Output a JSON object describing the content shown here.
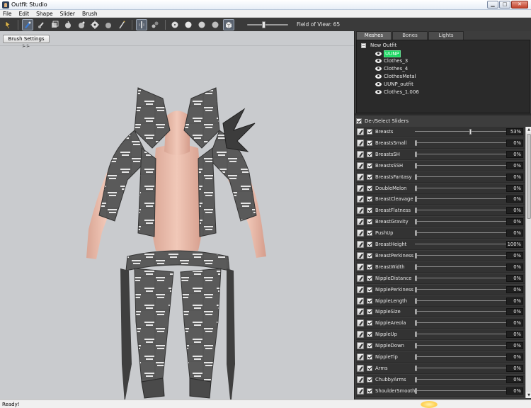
{
  "window": {
    "title": "Outfit Studio",
    "buttons": [
      "▁",
      "□",
      "✕"
    ]
  },
  "menu": [
    "File",
    "Edit",
    "Shape",
    "Slider",
    "Brush"
  ],
  "toolbar": {
    "field_of_view_label": "Field of View: 65",
    "field_of_view_level": 0.4,
    "icons": [
      "select-icon",
      "inflate-brush-icon",
      "deflate-brush-icon",
      "move-brush-icon",
      "smooth-brush-icon",
      "weight-brush-icon",
      "color-brush-icon",
      "edit-icon",
      "transform-icon",
      "pivot-icon",
      "vertex-mode-icon",
      "edge-mode-icon",
      "light-mode-icon",
      "smooth-shading-icon",
      "flat-shading-icon",
      "texture-icon"
    ]
  },
  "viewport": {
    "brush_settings_label": "Brush Settings >>"
  },
  "panel": {
    "tabs": [
      {
        "label": "Meshes",
        "active": true
      },
      {
        "label": "Bones",
        "active": false
      },
      {
        "label": "Lights",
        "active": false
      }
    ],
    "tree": {
      "root": "New Outfit",
      "expander": "−",
      "items": [
        {
          "label": "UUNP",
          "selected": true
        },
        {
          "label": "Clothes_3",
          "selected": false
        },
        {
          "label": "Clothes_4",
          "selected": false
        },
        {
          "label": "ClothesMetal",
          "selected": false
        },
        {
          "label": "UUNP_outfit",
          "selected": false
        },
        {
          "label": "Clothes_1.006",
          "selected": false
        }
      ]
    },
    "slider_header": "De-/Select Sliders",
    "sliders": [
      {
        "name": "Breasts",
        "value": 53,
        "display": "53%"
      },
      {
        "name": "BreastsSmall",
        "value": 0,
        "display": "0%"
      },
      {
        "name": "BreastsSH",
        "value": 0,
        "display": "0%"
      },
      {
        "name": "BreastsSSH",
        "value": 0,
        "display": "0%"
      },
      {
        "name": "BreastsFantasy",
        "value": 0,
        "display": "0%"
      },
      {
        "name": "DoubleMelon",
        "value": 0,
        "display": "0%"
      },
      {
        "name": "BreastCleavage",
        "value": 0,
        "display": "0%"
      },
      {
        "name": "BreastFlatness",
        "value": 0,
        "display": "0%"
      },
      {
        "name": "BreastGravity",
        "value": 0,
        "display": "0%"
      },
      {
        "name": "PushUp",
        "value": 0,
        "display": "0%"
      },
      {
        "name": "BreastHeight",
        "value": 100,
        "display": "100%"
      },
      {
        "name": "BreastPerkiness",
        "value": 0,
        "display": "0%"
      },
      {
        "name": "BreastWidth",
        "value": 0,
        "display": "0%"
      },
      {
        "name": "NippleDistance",
        "value": 0,
        "display": "0%"
      },
      {
        "name": "NipplePerkiness",
        "value": 0,
        "display": "0%"
      },
      {
        "name": "NippleLength",
        "value": 0,
        "display": "0%"
      },
      {
        "name": "NippleSize",
        "value": 0,
        "display": "0%"
      },
      {
        "name": "NippleAreola",
        "value": 0,
        "display": "0%"
      },
      {
        "name": "NippleUp",
        "value": 0,
        "display": "0%"
      },
      {
        "name": "NippleDown",
        "value": 0,
        "display": "0%"
      },
      {
        "name": "NippleTip",
        "value": 0,
        "display": "0%"
      },
      {
        "name": "Arms",
        "value": 0,
        "display": "0%"
      },
      {
        "name": "ChubbyArms",
        "value": 0,
        "display": "0%"
      },
      {
        "name": "ShoulderSmooth",
        "value": 0,
        "display": "0%"
      }
    ]
  },
  "statusbar": {
    "text": "Ready!"
  },
  "colors": {
    "selected_mesh": "#16d65e",
    "panel_bg": "#3d3d3d",
    "viewport_bg": "#c9cbce",
    "toolbar_bg": "#3a3a3a"
  }
}
